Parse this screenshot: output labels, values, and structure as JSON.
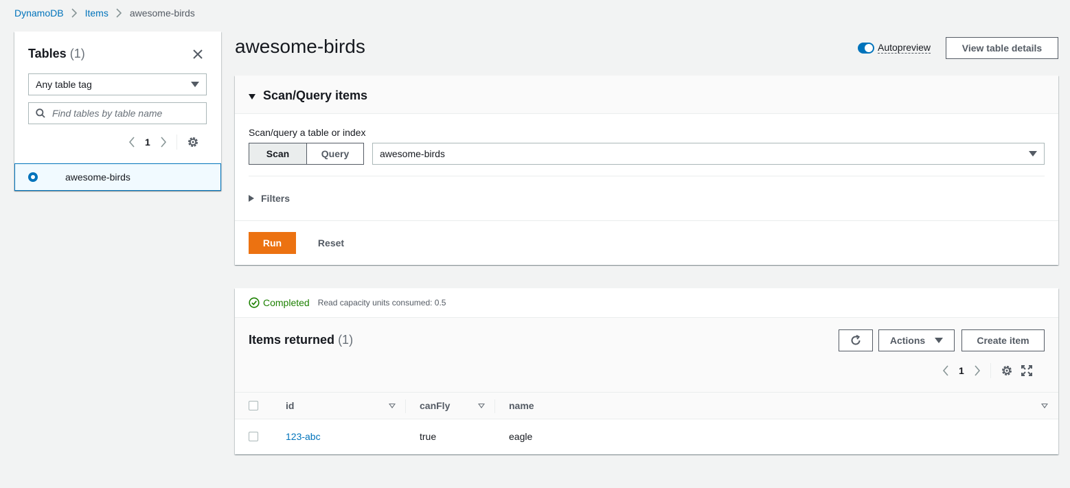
{
  "breadcrumb": {
    "items": [
      "DynamoDB",
      "Items"
    ],
    "current": "awesome-birds"
  },
  "tables_panel": {
    "title": "Tables",
    "count": "(1)",
    "tag_filter": "Any table tag",
    "search_placeholder": "Find tables by table name",
    "page": "1",
    "tables": [
      {
        "name": "awesome-birds",
        "selected": true
      }
    ]
  },
  "header": {
    "title": "awesome-birds",
    "autopreview_label": "Autopreview",
    "autopreview_on": true,
    "view_details_label": "View table details"
  },
  "scan": {
    "title": "Scan/Query items",
    "label": "Scan/query a table or index",
    "mode_scan": "Scan",
    "mode_query": "Query",
    "selected_table": "awesome-birds",
    "filters_label": "Filters",
    "run_label": "Run",
    "reset_label": "Reset"
  },
  "results": {
    "status": "Completed",
    "status_note": "Read capacity units consumed: 0.5",
    "title": "Items returned",
    "count": "(1)",
    "actions_label": "Actions",
    "create_label": "Create item",
    "page": "1",
    "columns": [
      "id",
      "canFly",
      "name"
    ],
    "rows": [
      {
        "id": "123-abc",
        "canFly": "true",
        "name": "eagle"
      }
    ]
  },
  "colors": {
    "accent": "#0073bb",
    "primary_button": "#ec7211",
    "success": "#1d8102"
  }
}
